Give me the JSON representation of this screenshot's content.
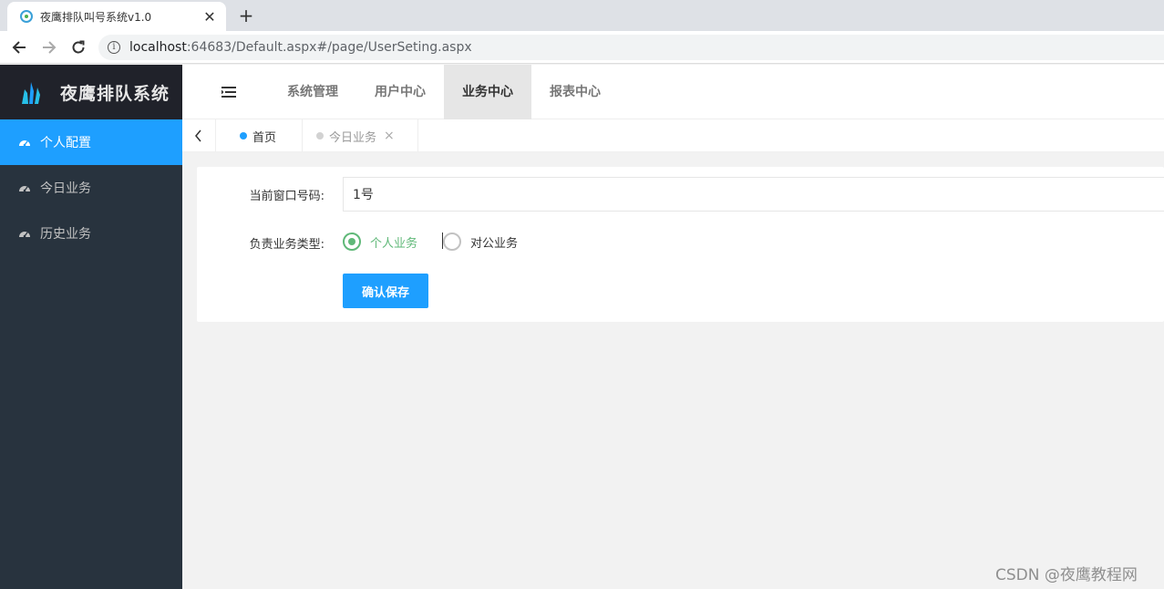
{
  "browser": {
    "tab_title": "夜鹰排队叫号系统v1.0",
    "tab_close": "✕",
    "new_tab": "+",
    "url_host": "localhost",
    "url_rest": ":64683/Default.aspx#/page/UserSeting.aspx"
  },
  "app": {
    "logo_text": "夜鹰排队系统"
  },
  "sidebar": {
    "items": [
      {
        "label": "个人配置"
      },
      {
        "label": "今日业务"
      },
      {
        "label": "历史业务"
      }
    ]
  },
  "top_nav": {
    "items": [
      {
        "label": "系统管理"
      },
      {
        "label": "用户中心"
      },
      {
        "label": "业务中心"
      },
      {
        "label": "报表中心"
      }
    ]
  },
  "page_tabs": {
    "home": "首页",
    "today": "今日业务",
    "close": "×"
  },
  "form": {
    "window_label": "当前窗口号码:",
    "window_value": "1号",
    "type_label": "负责业务类型:",
    "options": [
      {
        "label": "个人业务",
        "checked": true
      },
      {
        "label": "对公业务",
        "checked": false
      }
    ],
    "save_label": "确认保存"
  },
  "watermark": "CSDN @夜鹰教程网",
  "colors": {
    "primary": "#1e9fff",
    "sidebar_bg": "#28333e",
    "logo_bg": "#20222a",
    "radio_checked": "#5fb878"
  }
}
